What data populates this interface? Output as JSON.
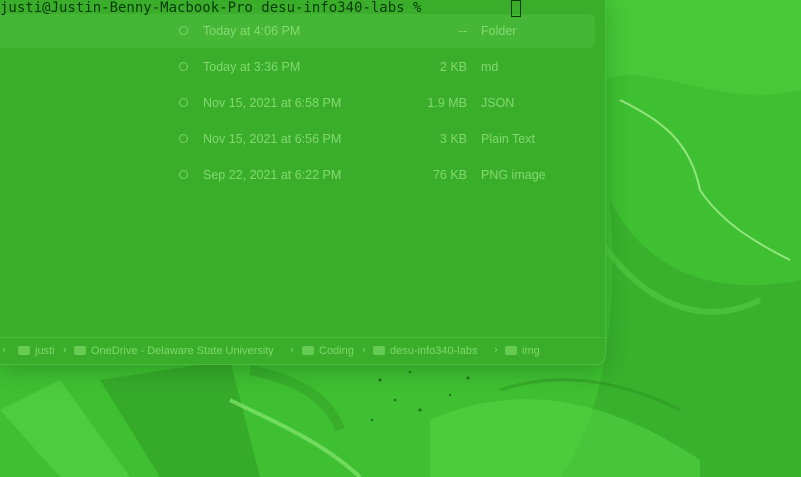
{
  "terminal": {
    "prompt": "justi@Justin-Benny-Macbook-Pro desu-info340-labs % "
  },
  "finder": {
    "rows": [
      {
        "date": "Today at 4:06 PM",
        "size": "--",
        "kind": "Folder"
      },
      {
        "date": "Today at 3:36 PM",
        "size": "2 KB",
        "kind": "md"
      },
      {
        "date": "Nov 15, 2021 at 6:58 PM",
        "size": "1.9 MB",
        "kind": "JSON"
      },
      {
        "date": "Nov 15, 2021 at 6:56 PM",
        "size": "3 KB",
        "kind": "Plain Text"
      },
      {
        "date": "Sep 22, 2021 at 6:22 PM",
        "size": "76 KB",
        "kind": "PNG image"
      }
    ],
    "path": [
      "justi",
      "OneDrive - Delaware State University",
      "Coding",
      "desu-info340-labs",
      "img"
    ],
    "path_separator": "›",
    "sync_icon": "icloud-status-icon",
    "folder_icon": "folder-icon"
  },
  "colors": {
    "background": "#3fbf32",
    "window": "#3aae2b",
    "text": "#96e682"
  }
}
